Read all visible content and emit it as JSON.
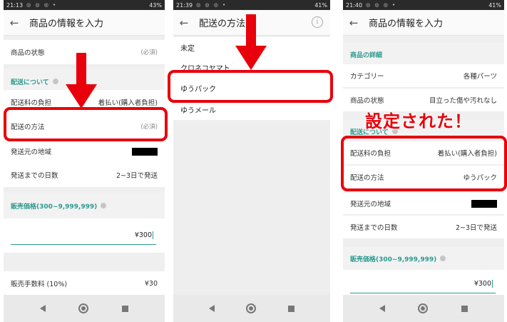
{
  "colors": {
    "accent": "#2a9a8e",
    "highlight": "#e8000b",
    "statusbar": "#2a2a2a"
  },
  "screen1": {
    "status": {
      "time": "21:13",
      "battery": "43%"
    },
    "title": "商品の情報を入力",
    "condition_label": "商品の状態",
    "condition_value": "(必須)",
    "shipping_section": "配送について",
    "fee_label": "配送料の負担",
    "fee_value": "着払い(購入者負担)",
    "method_label": "配送の方法",
    "method_value": "(必須)",
    "origin_label": "発送元の地域",
    "days_label": "発送までの日数",
    "days_value": "2~3日で発送",
    "price_section": "販売価格(300~9,999,999)",
    "price_value": "¥300",
    "commission_label": "販売手数料 (10%)",
    "commission_value": "¥30"
  },
  "screen2": {
    "status": {
      "time": "21:39",
      "battery": "41%"
    },
    "title": "配送の方法",
    "options": [
      "未定",
      "クロネコヤマト",
      "ゆうパック",
      "ゆうメール"
    ]
  },
  "screen3": {
    "status": {
      "time": "21:40",
      "battery": "41%"
    },
    "title": "商品の情報を入力",
    "details_section": "商品の詳細",
    "category_label": "カテゴリー",
    "category_value": "各種パーツ",
    "condition_label": "商品の状態",
    "condition_value": "目立った傷や汚れなし",
    "shipping_section": "配送について",
    "fee_label": "配送料の負担",
    "fee_value": "着払い(購入者負担)",
    "method_label": "配送の方法",
    "method_value": "ゆうパック",
    "origin_label": "発送元の地域",
    "days_label": "発送までの日数",
    "days_value": "2~3日で発送",
    "price_section": "販売価格(300~9,999,999)",
    "price_value": "¥300",
    "callout": "設定された！"
  },
  "icons": {
    "back": "←",
    "info": "i",
    "status_icons": "◎ ◎ ◎ •"
  }
}
